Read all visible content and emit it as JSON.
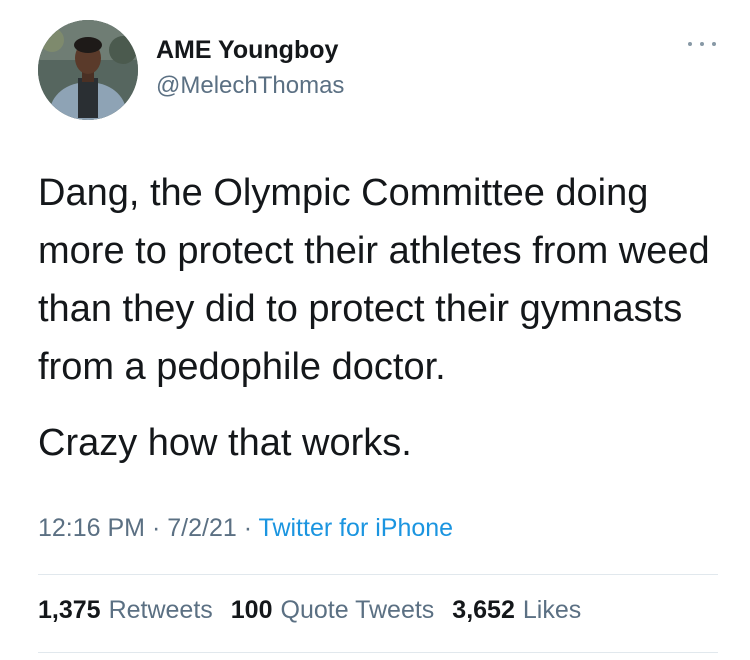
{
  "tweet": {
    "user": {
      "display_name": "AME Youngboy",
      "handle": "@MelechThomas"
    },
    "more_icon": "ellipsis-icon",
    "text_paragraphs": [
      "Dang, the Olympic Committee doing more to protect their athletes from weed than they did to protect their gymnasts from a pedophile doctor.",
      "Crazy how that works."
    ],
    "time": "12:16 PM",
    "date": "7/2/21",
    "source": "Twitter for iPhone",
    "separator": "·",
    "stats": {
      "retweets_count": "1,375",
      "retweets_label": "Retweets",
      "quotes_count": "100",
      "quotes_label": "Quote Tweets",
      "likes_count": "3,652",
      "likes_label": "Likes"
    },
    "colors": {
      "text": "#14171a",
      "secondary": "#5b7083",
      "link": "#1b95e0",
      "divider": "#e1e8ed"
    }
  }
}
